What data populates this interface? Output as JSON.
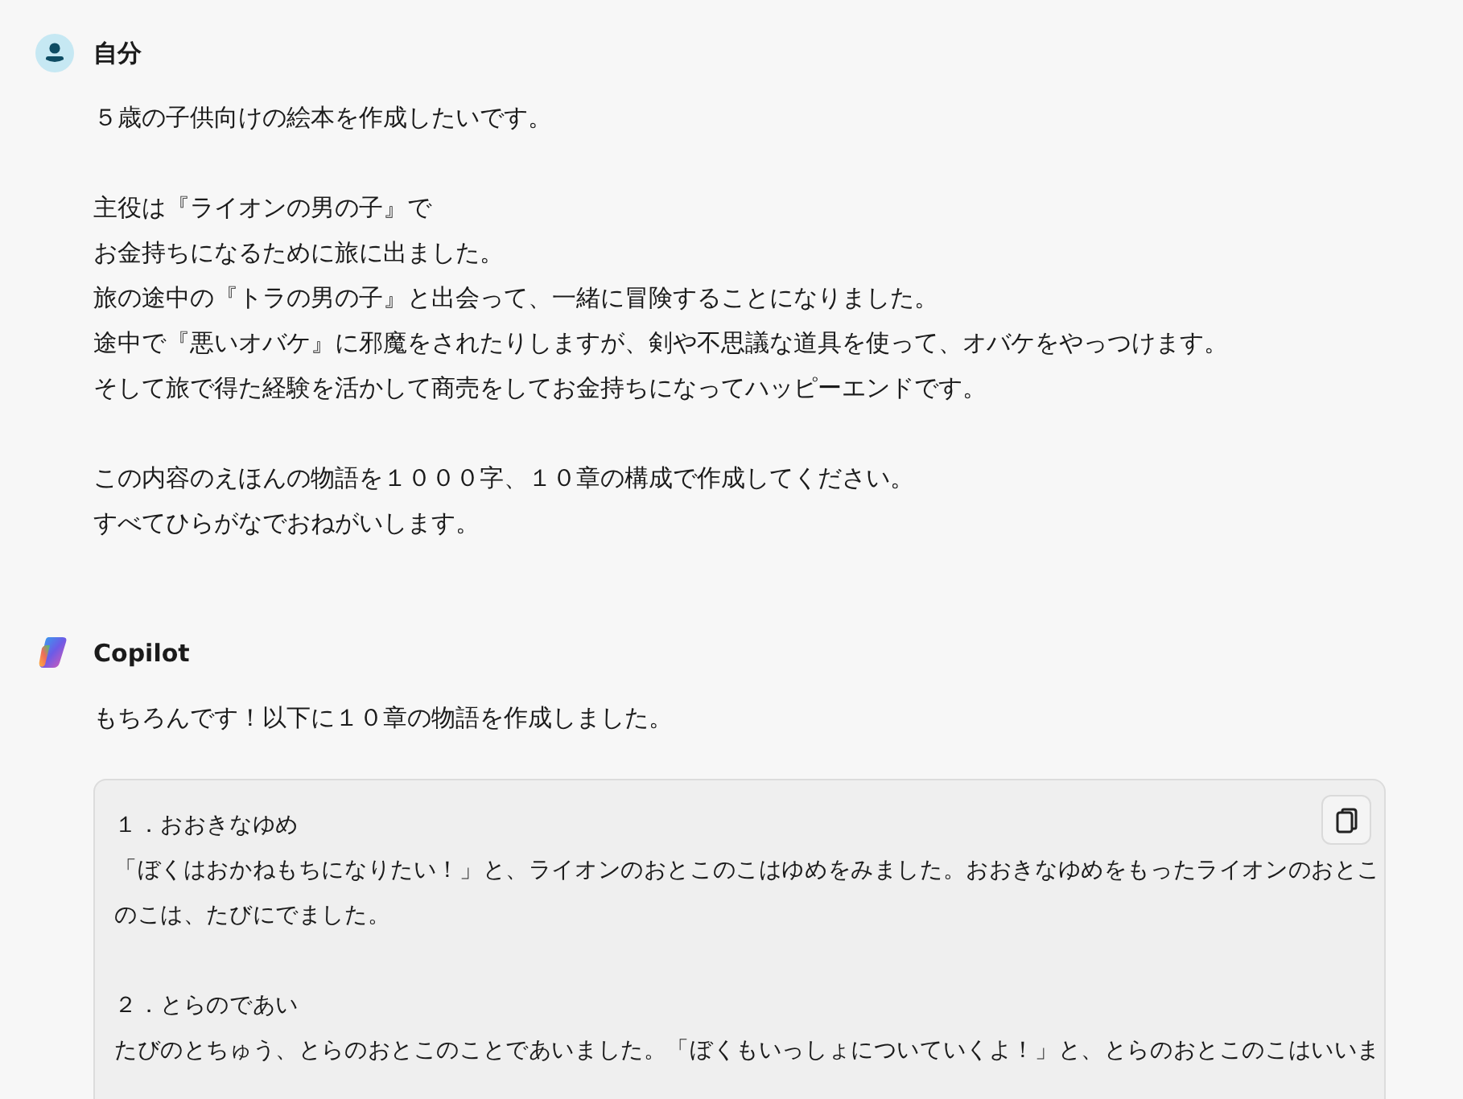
{
  "messages": [
    {
      "kind": "user",
      "author": "自分",
      "paragraphs": [
        [
          "５歳の子供向けの絵本を作成したいです。"
        ],
        [
          "主役は『ライオンの男の子』で",
          "お金持ちになるために旅に出ました。",
          "旅の途中の『トラの男の子』と出会って、一緒に冒険することになりました。",
          "途中で『悪いオバケ』に邪魔をされたりしますが、剣や不思議な道具を使って、オバケをやっつけます。",
          "そして旅で得た経験を活かして商売をしてお金持ちになってハッピーエンドです。"
        ],
        [
          "この内容のえほんの物語を１０００字、１０章の構成で作成してください。",
          "すべてひらがなでおねがいします。"
        ]
      ]
    },
    {
      "kind": "assistant",
      "author": "Copilot",
      "paragraphs": [
        [
          "もちろんです！以下に１０章の物語を作成しました。"
        ]
      ],
      "code_block": {
        "paragraphs": [
          [
            "１．おおきなゆめ",
            "「ぼくはおかねもちになりたい！」と、ライオンのおとこのこはゆめをみました。おおきなゆめをもったライオンのおとこ",
            "のこは、たびにでました。"
          ],
          [
            "２．とらのであい",
            "たびのとちゅう、とらのおとこのことであいました。「ぼくもいっしょについていくよ！」と、とらのおとこのこはいいま"
          ]
        ]
      }
    }
  ]
}
